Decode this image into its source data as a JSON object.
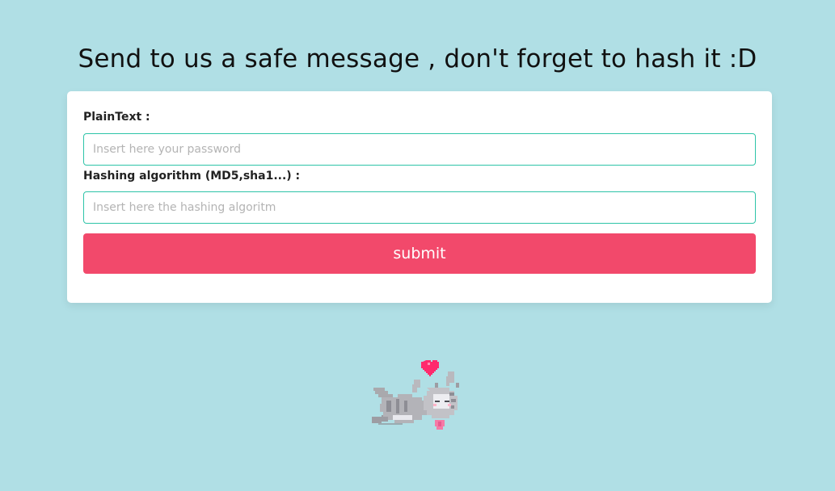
{
  "header": {
    "title": "Send to us a safe message , don't forget to hash it :D"
  },
  "form": {
    "plaintext_label": "PlainText :",
    "plaintext_placeholder": "Insert here your password",
    "plaintext_value": "",
    "algorithm_label": "Hashing algorithm (MD5,sha1...) :",
    "algorithm_placeholder": "Insert here the hashing algoritm",
    "algorithm_value": "",
    "submit_label": "submit"
  },
  "colors": {
    "background": "#b0dfe5",
    "input_border": "#2ec4a8",
    "submit_button": "#f2496b",
    "heart": "#ff2a6d"
  },
  "decoration": {
    "image": "cat-with-heart-pixel-art"
  }
}
